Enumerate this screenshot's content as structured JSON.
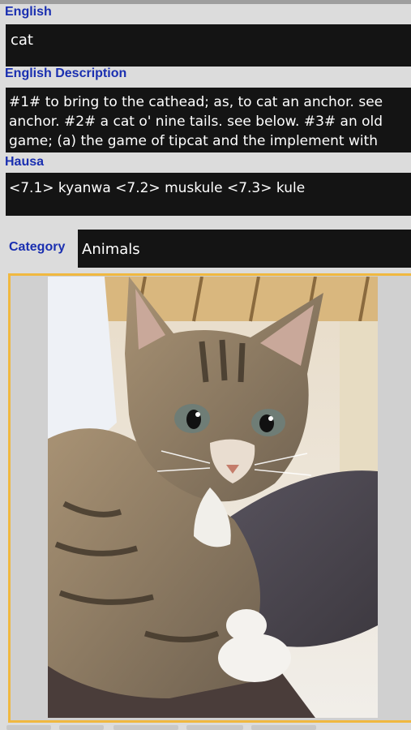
{
  "fields": {
    "english_label": "English",
    "english_value": "cat",
    "description_label": "English Description",
    "description_value": "#1# to bring to the cathead; as, to cat an anchor. see anchor. #2# a cat o' nine tails. see below. #3# an old game; (a) the game of tipcat and the implement with",
    "hausa_label": "Hausa",
    "hausa_value": "<7.1> kyanwa <7.2> muskule <7.3> kule",
    "category_label": "Category",
    "category_value": "Animals"
  },
  "image": {
    "icon": "kitten-photo",
    "frame_color": "#f0b840"
  },
  "colors": {
    "label": "#1a2fb0",
    "field_bg": "#141414",
    "page_bg": "#dcdcdc"
  }
}
